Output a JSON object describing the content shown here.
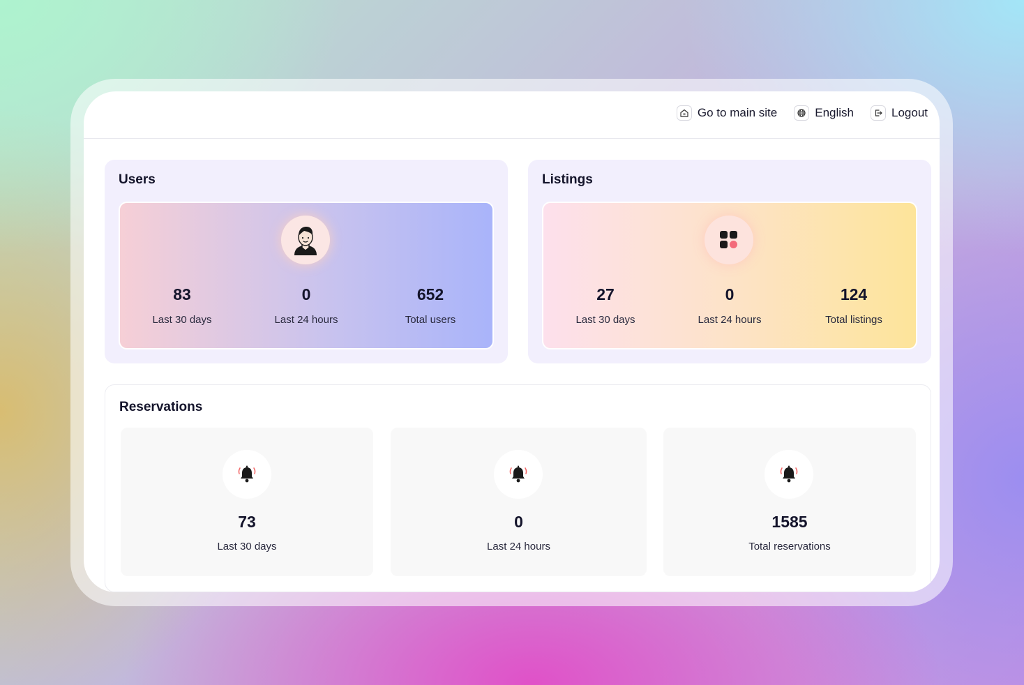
{
  "topbar": {
    "main_site": {
      "label": "Go to main site",
      "icon": "home-icon"
    },
    "language": {
      "label": "English",
      "icon": "globe-icon"
    },
    "logout": {
      "label": "Logout",
      "icon": "logout-icon"
    }
  },
  "users": {
    "title": "Users",
    "icon": "user-avatar-icon",
    "stats": [
      {
        "value": "83",
        "label": "Last 30 days"
      },
      {
        "value": "0",
        "label": "Last 24 hours"
      },
      {
        "value": "652",
        "label": "Total users"
      }
    ]
  },
  "listings": {
    "title": "Listings",
    "icon": "grid-apps-icon",
    "stats": [
      {
        "value": "27",
        "label": "Last 30 days"
      },
      {
        "value": "0",
        "label": "Last 24 hours"
      },
      {
        "value": "124",
        "label": "Total listings"
      }
    ]
  },
  "reservations": {
    "title": "Reservations",
    "icon": "bell-icon",
    "stats": [
      {
        "value": "73",
        "label": "Last 30 days"
      },
      {
        "value": "0",
        "label": "Last 24 hours"
      },
      {
        "value": "1585",
        "label": "Total reservations"
      }
    ]
  },
  "colors": {
    "panel_bg": "#f2effd",
    "card_bg": "#f8f8f8",
    "text_dark": "#14142b",
    "bell_accent": "#f26a6a"
  }
}
